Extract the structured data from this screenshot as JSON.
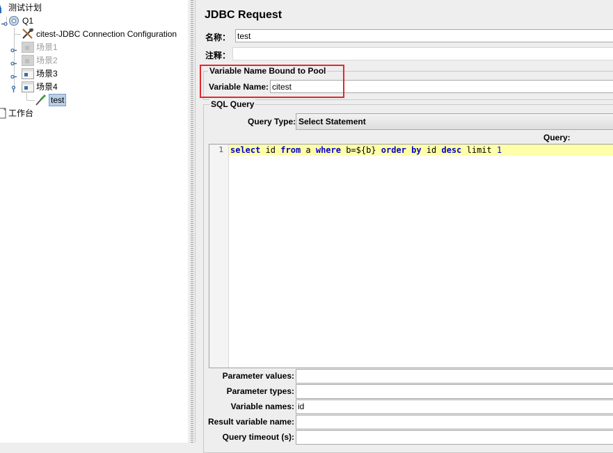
{
  "tree": {
    "root": "测试计划",
    "thread_group": "Q1",
    "config": "citest-JDBC Connection Configuration",
    "scenario1": "场景1",
    "scenario2": "场景2",
    "scenario3": "场景3",
    "scenario4": "场景4",
    "selected": "test",
    "workbench": "工作台"
  },
  "panel": {
    "title": "JDBC Request",
    "name_label": "名称：",
    "name_value": "test",
    "comment_label": "注释：",
    "comment_value": ""
  },
  "pool_group": {
    "title": "Variable Name Bound to Pool",
    "var_label": "Variable Name:",
    "var_value": "citest"
  },
  "sql_group": {
    "title": "SQL Query",
    "query_type_label": "Query Type:",
    "query_type_value": "Select Statement",
    "query_label": "Query:",
    "line_number": "1",
    "code": {
      "t1": "select",
      "t2": " id ",
      "t3": "from",
      "t4": " a ",
      "t5": "where",
      "t6": " b=${b} ",
      "t7": "order",
      "t8": " ",
      "t9": "by",
      "t10": " id ",
      "t11": "desc",
      "t12": " limit ",
      "t13": "1"
    }
  },
  "params": [
    {
      "label": "Parameter values:",
      "value": ""
    },
    {
      "label": "Parameter types:",
      "value": ""
    },
    {
      "label": "Variable names:",
      "value": "id"
    },
    {
      "label": "Result variable name:",
      "value": ""
    },
    {
      "label": "Query timeout (s):",
      "value": ""
    }
  ],
  "colors": {
    "highlight_box": "#e2282c",
    "current_line": "#ffffaa",
    "keyword": "#0000cc",
    "selection": "#b8cfe5"
  }
}
